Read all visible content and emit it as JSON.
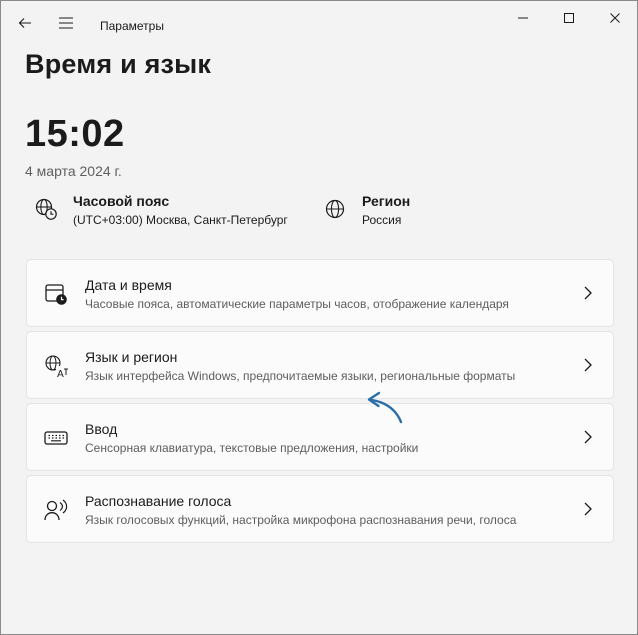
{
  "window": {
    "app_title": "Параметры",
    "back_icon": "back-arrow-icon",
    "menu_icon": "hamburger-menu-icon",
    "controls": [
      "minimize-icon",
      "maximize-icon",
      "close-icon"
    ]
  },
  "page": {
    "title": "Время и язык",
    "clock": "15:02",
    "date": "4 марта 2024 г."
  },
  "info": {
    "timezone": {
      "icon": "globe-clock-icon",
      "title": "Часовой пояс",
      "value": "(UTC+03:00) Москва, Санкт-Петербург"
    },
    "region": {
      "icon": "globe-icon",
      "title": "Регион",
      "value": "Россия"
    }
  },
  "cards": [
    {
      "icon": "calendar-clock-icon",
      "title": "Дата и время",
      "subtitle": "Часовые пояса, автоматические параметры часов, отображение календаря"
    },
    {
      "icon": "language-icon",
      "title": "Язык и регион",
      "subtitle": "Язык интерфейса Windows, предпочитаемые языки, региональные форматы"
    },
    {
      "icon": "keyboard-icon",
      "title": "Ввод",
      "subtitle": "Сенсорная клавиатура, текстовые предложения, настройки"
    },
    {
      "icon": "speech-icon",
      "title": "Распознавание голоса",
      "subtitle": "Язык голосовых функций, настройка микрофона распознавания речи, голоса"
    }
  ],
  "colors": {
    "background": "#f3f3f3",
    "card": "#fbfbfb",
    "annotation_arrow": "#2a6fa8"
  }
}
